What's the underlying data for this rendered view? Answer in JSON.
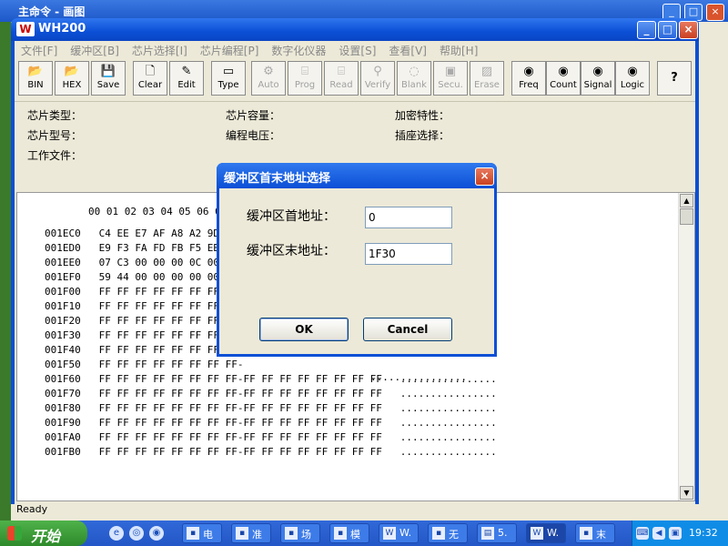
{
  "bg_window": {
    "title": "主命令 - 画图"
  },
  "main_window": {
    "title": "WH200",
    "logo": "W"
  },
  "menu": [
    "文件[F]",
    "缓冲区[B]",
    "芯片选择[I]",
    "芯片编程[P]",
    "数字化仪器",
    "设置[S]",
    "查看[V]",
    "帮助[H]"
  ],
  "toolbar": [
    {
      "label": "BIN",
      "icon": "open-folder-icon",
      "glyph": "📂",
      "enabled": true
    },
    {
      "label": "HEX",
      "icon": "open-folder-icon",
      "glyph": "📂",
      "enabled": true
    },
    {
      "label": "Save",
      "icon": "floppy-icon",
      "glyph": "💾",
      "enabled": true
    },
    {
      "label": "Clear",
      "icon": "page-icon",
      "glyph": "🗋",
      "enabled": true
    },
    {
      "label": "Edit",
      "icon": "pencil-icon",
      "glyph": "✎",
      "enabled": true
    },
    {
      "label": "Type",
      "icon": "chip-icon",
      "glyph": "▭",
      "enabled": true
    },
    {
      "label": "Auto",
      "icon": "auto-icon",
      "glyph": "⚙",
      "enabled": false
    },
    {
      "label": "Prog",
      "icon": "prog-icon",
      "glyph": "⌸",
      "enabled": false
    },
    {
      "label": "Read",
      "icon": "read-icon",
      "glyph": "⌸",
      "enabled": false
    },
    {
      "label": "Verify",
      "icon": "verify-icon",
      "glyph": "⚲",
      "enabled": false
    },
    {
      "label": "Blank",
      "icon": "bulb-icon",
      "glyph": "◌",
      "enabled": false
    },
    {
      "label": "Secu.",
      "icon": "lock-icon",
      "glyph": "▣",
      "enabled": false
    },
    {
      "label": "Erase",
      "icon": "erase-icon",
      "glyph": "▨",
      "enabled": false
    },
    {
      "label": "Freq",
      "icon": "freq-icon",
      "glyph": "◉",
      "enabled": true
    },
    {
      "label": "Count",
      "icon": "count-icon",
      "glyph": "◉",
      "enabled": true
    },
    {
      "label": "Signal",
      "icon": "signal-icon",
      "glyph": "◉",
      "enabled": true
    },
    {
      "label": "Logic",
      "icon": "logic-icon",
      "glyph": "◉",
      "enabled": true
    },
    {
      "label": "",
      "icon": "help-icon",
      "glyph": "?",
      "enabled": true
    }
  ],
  "info": {
    "chip_type": "芯片类型：",
    "chip_model": "芯片型号：",
    "work_file": "工作文件：",
    "chip_capacity": "芯片容量：",
    "prog_voltage": "编程电压：",
    "encrypt": "加密特性：",
    "socket": "插座选择："
  },
  "hex": {
    "header": "00 01 02 03 04 05 06 07-",
    "rows": [
      "001EC0   C4 EE E7 AF A8 A2 9D 9E-",
      "001ED0   E9 F3 FA FD FB F5 EB EC-",
      "001EE0   07 C3 00 00 00 0C 00 00-",
      "001EF0   59 44 00 00 00 00 00 00-",
      "001F00   FF FF FF FF FF FF FF FF-",
      "001F10   FF FF FF FF FF FF FF FF-",
      "001F20   FF FF FF FF FF FF FF FF-",
      "001F30   FF FF FF FF FF FF FF FF-",
      "001F40   FF FF FF FF FF FF FF FF-",
      "001F50   FF FF FF FF FF FF FF FF-",
      "001F60   FF FF FF FF FF FF FF FF-FF FF FF FF FF FF FF FF   ................",
      "001F70   FF FF FF FF FF FF FF FF-FF FF FF FF FF FF FF FF   ................",
      "001F80   FF FF FF FF FF FF FF FF-FF FF FF FF FF FF FF FF   ................",
      "001F90   FF FF FF FF FF FF FF FF-FF FF FF FF FF FF FF FF   ................",
      "001FA0   FF FF FF FF FF FF FF FF-FF FF FF FF FF FF FF FF   ................",
      "001FB0   FF FF FF FF FF FF FF FF-FF FF FF FF FF FF FF FF   ................"
    ],
    "tail_row50": "................"
  },
  "status": "Ready",
  "dialog": {
    "title": "缓冲区首末地址选择",
    "start_label": "缓冲区首地址：",
    "start_value": "0",
    "end_label": "缓冲区末地址：",
    "end_value": "1F30",
    "ok": "OK",
    "cancel": "Cancel"
  },
  "taskbar": {
    "start": "开始",
    "tasks": [
      {
        "label": "电",
        "icon": "app-icon"
      },
      {
        "label": "准",
        "icon": "app-icon"
      },
      {
        "label": "场",
        "icon": "app-icon"
      },
      {
        "label": "模",
        "icon": "app-icon"
      },
      {
        "label": "W.",
        "icon": "wh-icon"
      },
      {
        "label": "无",
        "icon": "doc-icon"
      },
      {
        "label": "5.",
        "icon": "folder-icon"
      },
      {
        "label": "W.",
        "icon": "wh-icon"
      },
      {
        "label": "末",
        "icon": "app-icon"
      }
    ],
    "clock": "19:32"
  }
}
